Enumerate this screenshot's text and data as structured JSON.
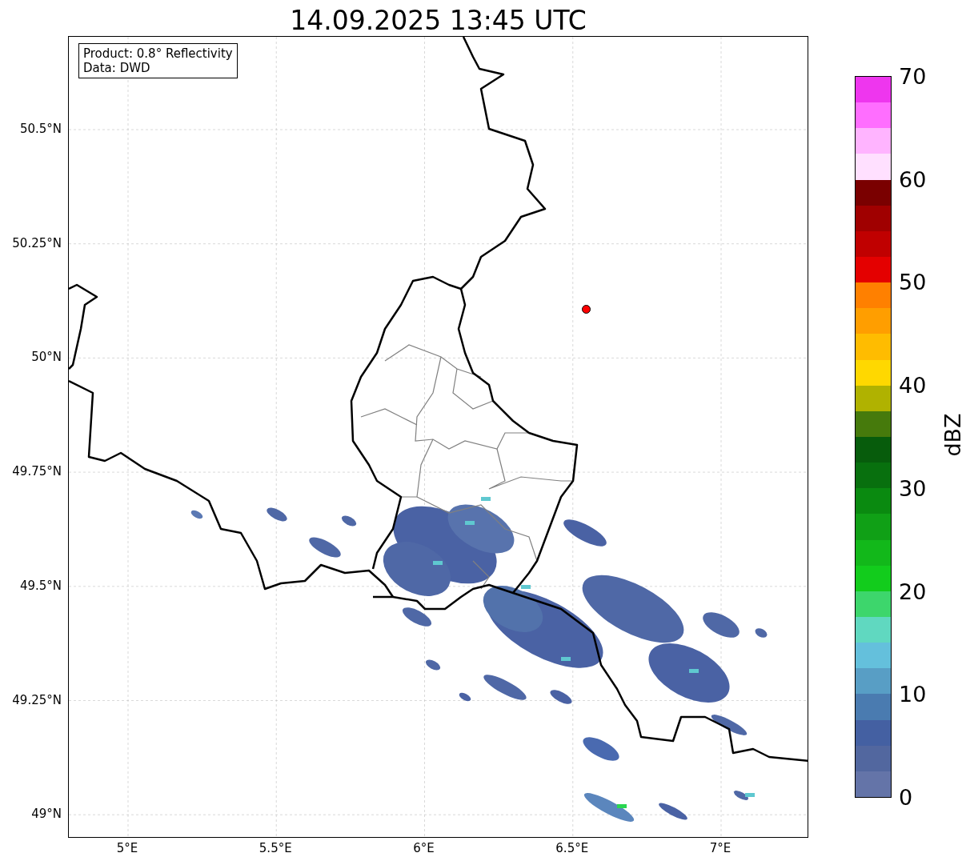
{
  "title": "14.09.2025 13:45 UTC",
  "info_box": [
    "Product: 0.8° Reflectivity",
    "Data: DWD"
  ],
  "map": {
    "latitude_ticks": [
      "50.5°N",
      "50.25°N",
      "50°N",
      "49.75°N",
      "49.5°N",
      "49.25°N",
      "49°N"
    ],
    "longitude_ticks": [
      "5°E",
      "5.5°E",
      "6°E",
      "6.5°E",
      "7°E"
    ]
  },
  "colorbar": {
    "label": "dBZ",
    "ticks": [
      "70",
      "60",
      "50",
      "40",
      "30",
      "20",
      "10",
      "0"
    ],
    "bands": [
      {
        "color": "#ee36ee"
      },
      {
        "color": "#ff6eff"
      },
      {
        "color": "#ffb4ff"
      },
      {
        "color": "#ffe0ff"
      },
      {
        "color": "#7a0000"
      },
      {
        "color": "#a00000"
      },
      {
        "color": "#c00000"
      },
      {
        "color": "#e40000"
      },
      {
        "color": "#ff8000"
      },
      {
        "color": "#ff9e00"
      },
      {
        "color": "#ffbc00"
      },
      {
        "color": "#ffd800"
      },
      {
        "color": "#b0b200"
      },
      {
        "color": "#467a0c"
      },
      {
        "color": "#075c0c"
      },
      {
        "color": "#08700e"
      },
      {
        "color": "#0a8a10"
      },
      {
        "color": "#10a016"
      },
      {
        "color": "#12b81a"
      },
      {
        "color": "#12cc1c"
      },
      {
        "color": "#3dd66c"
      },
      {
        "color": "#60d8c0"
      },
      {
        "color": "#64c0dc"
      },
      {
        "color": "#589ec5"
      },
      {
        "color": "#4a7bb0"
      },
      {
        "color": "#4460a2"
      },
      {
        "color": "#52679f"
      },
      {
        "color": "#6474a8"
      }
    ]
  }
}
